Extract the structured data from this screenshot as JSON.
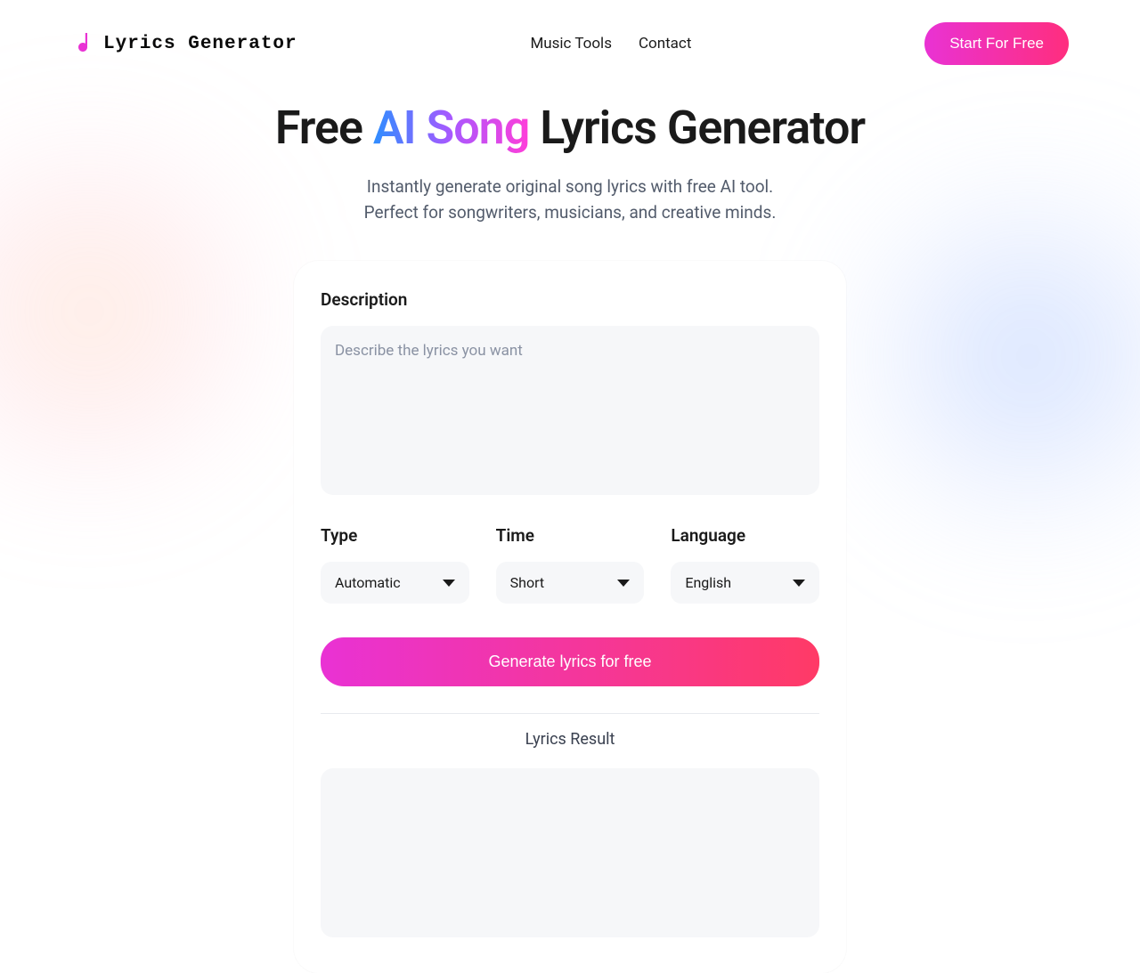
{
  "header": {
    "logo_text": "Lyrics Generator",
    "nav": {
      "music_tools": "Music Tools",
      "contact": "Contact"
    },
    "cta": "Start For Free"
  },
  "hero": {
    "title_pre": "Free ",
    "title_gradient": "AI Song",
    "title_post": " Lyrics Generator",
    "subtitle_line1": "Instantly generate original song lyrics with free AI tool.",
    "subtitle_line2": "Perfect for songwriters, musicians, and creative minds."
  },
  "form": {
    "description_label": "Description",
    "description_placeholder": "Describe the lyrics you want",
    "type_label": "Type",
    "type_value": "Automatic",
    "time_label": "Time",
    "time_value": "Short",
    "language_label": "Language",
    "language_value": "English",
    "generate_button": "Generate lyrics for free",
    "result_label": "Lyrics Result"
  }
}
